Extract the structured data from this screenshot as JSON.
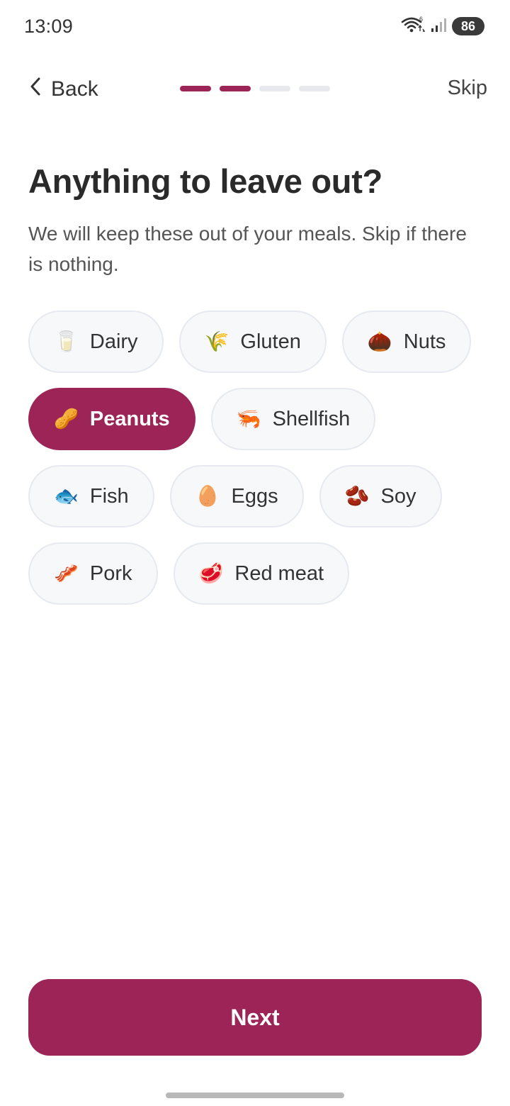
{
  "status_bar": {
    "time": "13:09",
    "wifi_badge": "6",
    "battery": "86"
  },
  "nav": {
    "back_label": "Back",
    "skip_label": "Skip",
    "progress": {
      "current_step": 2,
      "total_steps": 4,
      "accent": "#9c2456",
      "inactive": "#e7e9ee"
    }
  },
  "heading": {
    "title": "Anything to leave out?",
    "subtitle": "We will keep these out of your meals. Skip if there is nothing."
  },
  "chips": [
    {
      "emoji": "🥛",
      "label": "Dairy",
      "selected": false
    },
    {
      "emoji": "🌾",
      "label": "Gluten",
      "selected": false
    },
    {
      "emoji": "🌰",
      "label": "Nuts",
      "selected": false
    },
    {
      "emoji": "🥜",
      "label": "Peanuts",
      "selected": true
    },
    {
      "emoji": "🦐",
      "label": "Shellfish",
      "selected": false
    },
    {
      "emoji": "🐟",
      "label": "Fish",
      "selected": false
    },
    {
      "emoji": "🥚",
      "label": "Eggs",
      "selected": false
    },
    {
      "emoji": "🫘",
      "label": "Soy",
      "selected": false
    },
    {
      "emoji": "🥓",
      "label": "Pork",
      "selected": false
    },
    {
      "emoji": "🥩",
      "label": "Red meat",
      "selected": false
    }
  ],
  "footer": {
    "next_label": "Next"
  },
  "colors": {
    "accent": "#9c2456",
    "chip_bg": "#f7f8fa",
    "chip_border": "#e6e9ef"
  }
}
